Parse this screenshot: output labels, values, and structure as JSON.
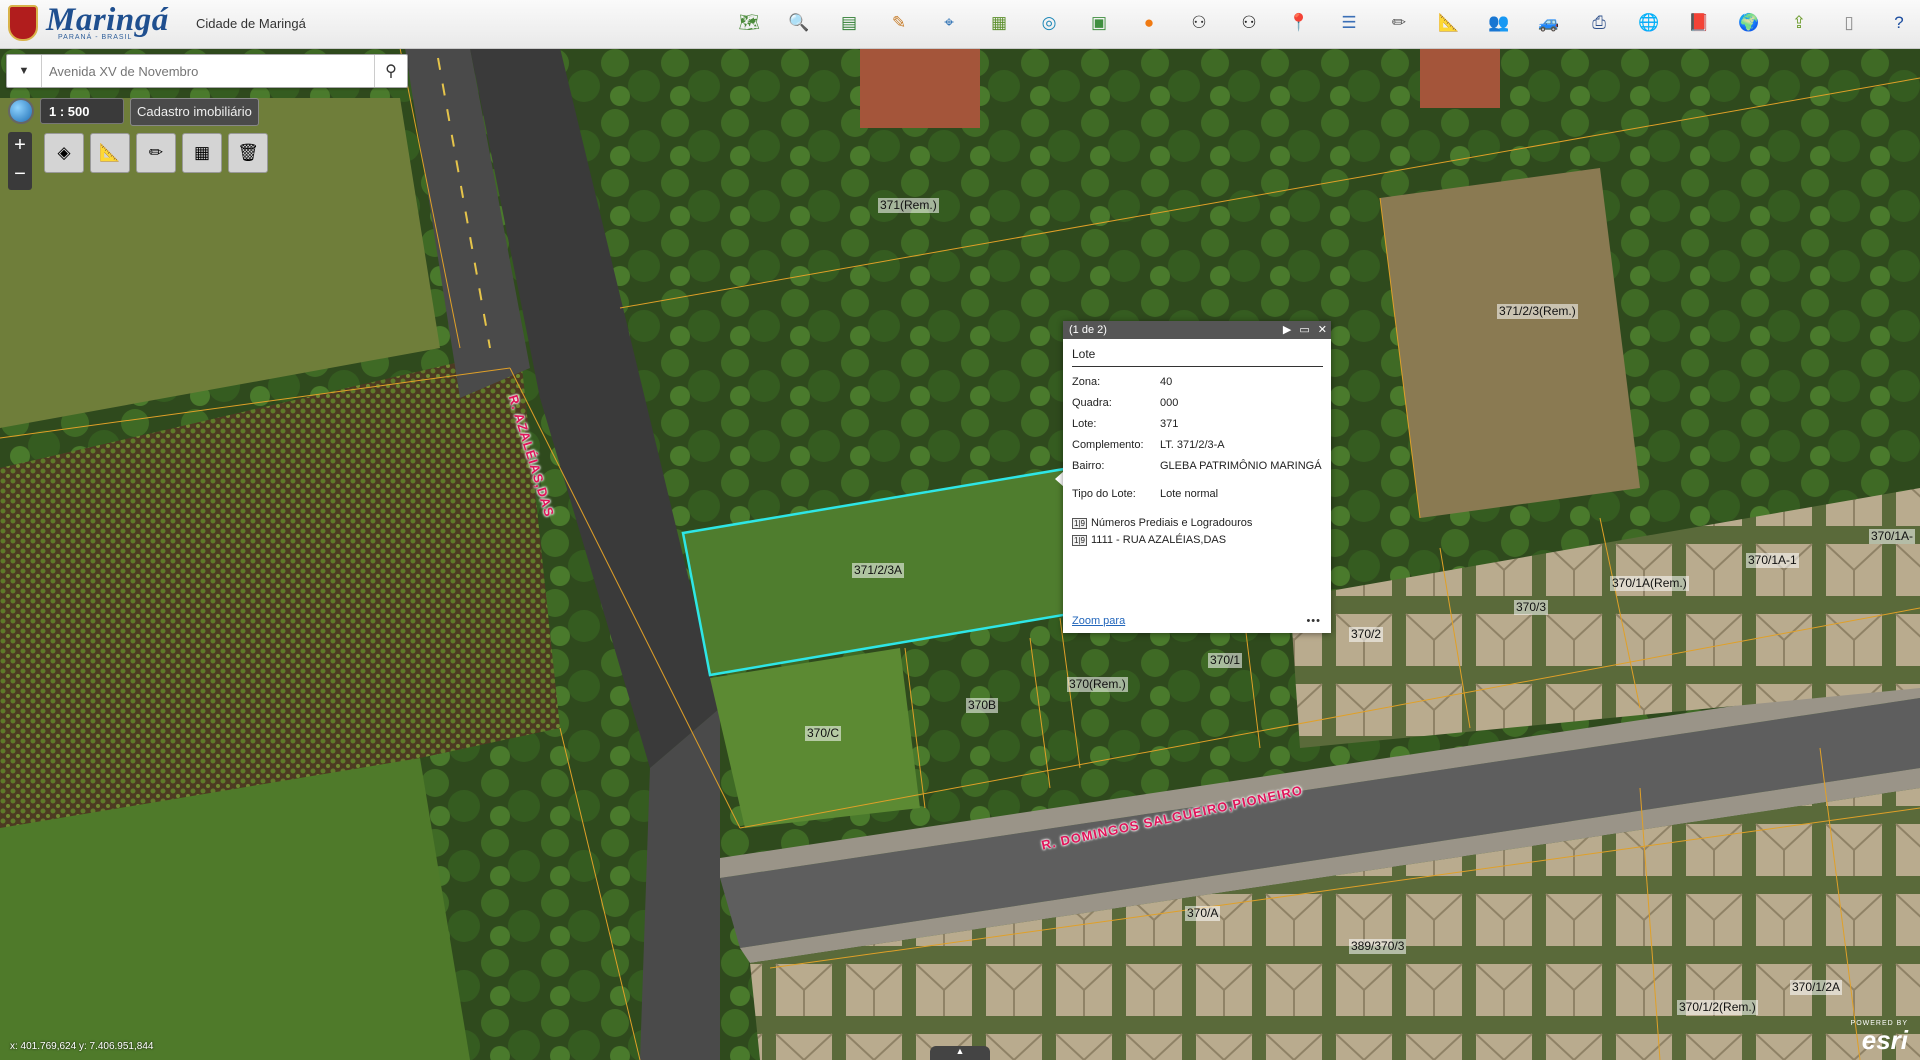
{
  "header": {
    "logo_text": "Maringá",
    "logo_subtitle": "PARANÁ - BRASIL",
    "app_title": "Cidade de Maringá",
    "tools": [
      {
        "name": "map-icon",
        "glyph": "🗺",
        "color": "#4a8a3a"
      },
      {
        "name": "search-doc-icon",
        "glyph": "🔍",
        "color": "#3560a8"
      },
      {
        "name": "layers-stack-icon",
        "glyph": "▤",
        "color": "#2e7d32"
      },
      {
        "name": "edit-doc-icon",
        "glyph": "✎",
        "color": "#c77d2a"
      },
      {
        "name": "coordinates-icon",
        "glyph": "⌖",
        "color": "#2a6fb3"
      },
      {
        "name": "report-icon",
        "glyph": "▦",
        "color": "#5c8f2c"
      },
      {
        "name": "locate-icon",
        "glyph": "◎",
        "color": "#1e88b8"
      },
      {
        "name": "parcel-icon",
        "glyph": "▣",
        "color": "#3f8f3f"
      },
      {
        "name": "orange-circle-icon",
        "glyph": "●",
        "color": "#f07a12"
      },
      {
        "name": "binoculars-icon",
        "glyph": "⚇",
        "color": "#333333"
      },
      {
        "name": "binoculars-dark-icon",
        "glyph": "⚇",
        "color": "#222222"
      },
      {
        "name": "pin-icon",
        "glyph": "📍",
        "color": "#c62828"
      },
      {
        "name": "list-icon",
        "glyph": "☰",
        "color": "#3b6fb6"
      },
      {
        "name": "pencil-icon",
        "glyph": "✏",
        "color": "#555555"
      },
      {
        "name": "ruler-icon",
        "glyph": "📐",
        "color": "#c7a21a"
      },
      {
        "name": "users-icon",
        "glyph": "👥",
        "color": "#c0392b"
      },
      {
        "name": "car-icon",
        "glyph": "🚙",
        "color": "#1565c0"
      },
      {
        "name": "printer-icon",
        "glyph": "⎙",
        "color": "#2d4f8a"
      },
      {
        "name": "globe-icon",
        "glyph": "🌐",
        "color": "#2e7d32"
      },
      {
        "name": "book-icon",
        "glyph": "📕",
        "color": "#b71c1c"
      },
      {
        "name": "world-search-icon",
        "glyph": "🌍",
        "color": "#1976d2"
      },
      {
        "name": "export-icon",
        "glyph": "⇪",
        "color": "#6a9a2a"
      },
      {
        "name": "document-icon",
        "glyph": "▯",
        "color": "#8a8a8a"
      },
      {
        "name": "help-icon",
        "glyph": "?",
        "color": "#1e4fa0"
      }
    ]
  },
  "search": {
    "value": "Avenida XV de Novembro",
    "placeholder": "Avenida XV de Novembro"
  },
  "scale": {
    "text": "1 :  500",
    "layer": "Cadastro imobiliário"
  },
  "zoom": {
    "in": "+",
    "out": "−"
  },
  "mini_tools": [
    {
      "name": "layers-icon",
      "glyph": "◈"
    },
    {
      "name": "measure-icon",
      "glyph": "📐"
    },
    {
      "name": "draw-icon",
      "glyph": "✏"
    },
    {
      "name": "basemap-grid-icon",
      "glyph": "▦"
    },
    {
      "name": "clear-graphics-icon",
      "glyph": "🗑"
    }
  ],
  "map": {
    "lot_labels": [
      {
        "text": "371(Rem.)"
      },
      {
        "text": "371/2/3(Rem.)"
      },
      {
        "text": "371/2/3A"
      },
      {
        "text": "370/1A(Rem.)"
      },
      {
        "text": "370/1A-1"
      },
      {
        "text": "370/1A-"
      },
      {
        "text": "370/3"
      },
      {
        "text": "370/2"
      },
      {
        "text": "370/1"
      },
      {
        "text": "370(Rem.)"
      },
      {
        "text": "370B"
      },
      {
        "text": "370/C"
      },
      {
        "text": "370/A"
      },
      {
        "text": "389/370/3"
      },
      {
        "text": "370/1/2A"
      },
      {
        "text": "370/1/2(Rem.)"
      }
    ],
    "street_labels": [
      {
        "text": "R. AZALÉIAS,DAS"
      },
      {
        "text": "R. DOMINGOS SALGUEIRO,PIONEIRO"
      }
    ],
    "coords": "x: 401.769,624   y: 7.406.951,844"
  },
  "popup": {
    "counter": "(1 de 2)",
    "next": "▶",
    "maximize": "▭",
    "close": "✕",
    "heading": "Lote",
    "fields": [
      {
        "k": "Zona:",
        "v": "40"
      },
      {
        "k": "Quadra:",
        "v": "000"
      },
      {
        "k": "Lote:",
        "v": "371"
      },
      {
        "k": "Complemento:",
        "v": "LT. 371/2/3-A"
      },
      {
        "k": "Bairro:",
        "v": "GLEBA PATRIMÔNIO MARINGÁ"
      },
      {
        "k": "Tipo do Lote:",
        "v": "Lote normal"
      }
    ],
    "related_title": "Números Prediais e Logradouros",
    "related_badge": "1|9",
    "related_item": "1111 - RUA AZALÉIAS,DAS",
    "related_item_badge": "1|9",
    "zoom_link": "Zoom para",
    "more": "•••"
  },
  "esri": {
    "powered": "POWERED BY",
    "name": "esri"
  }
}
